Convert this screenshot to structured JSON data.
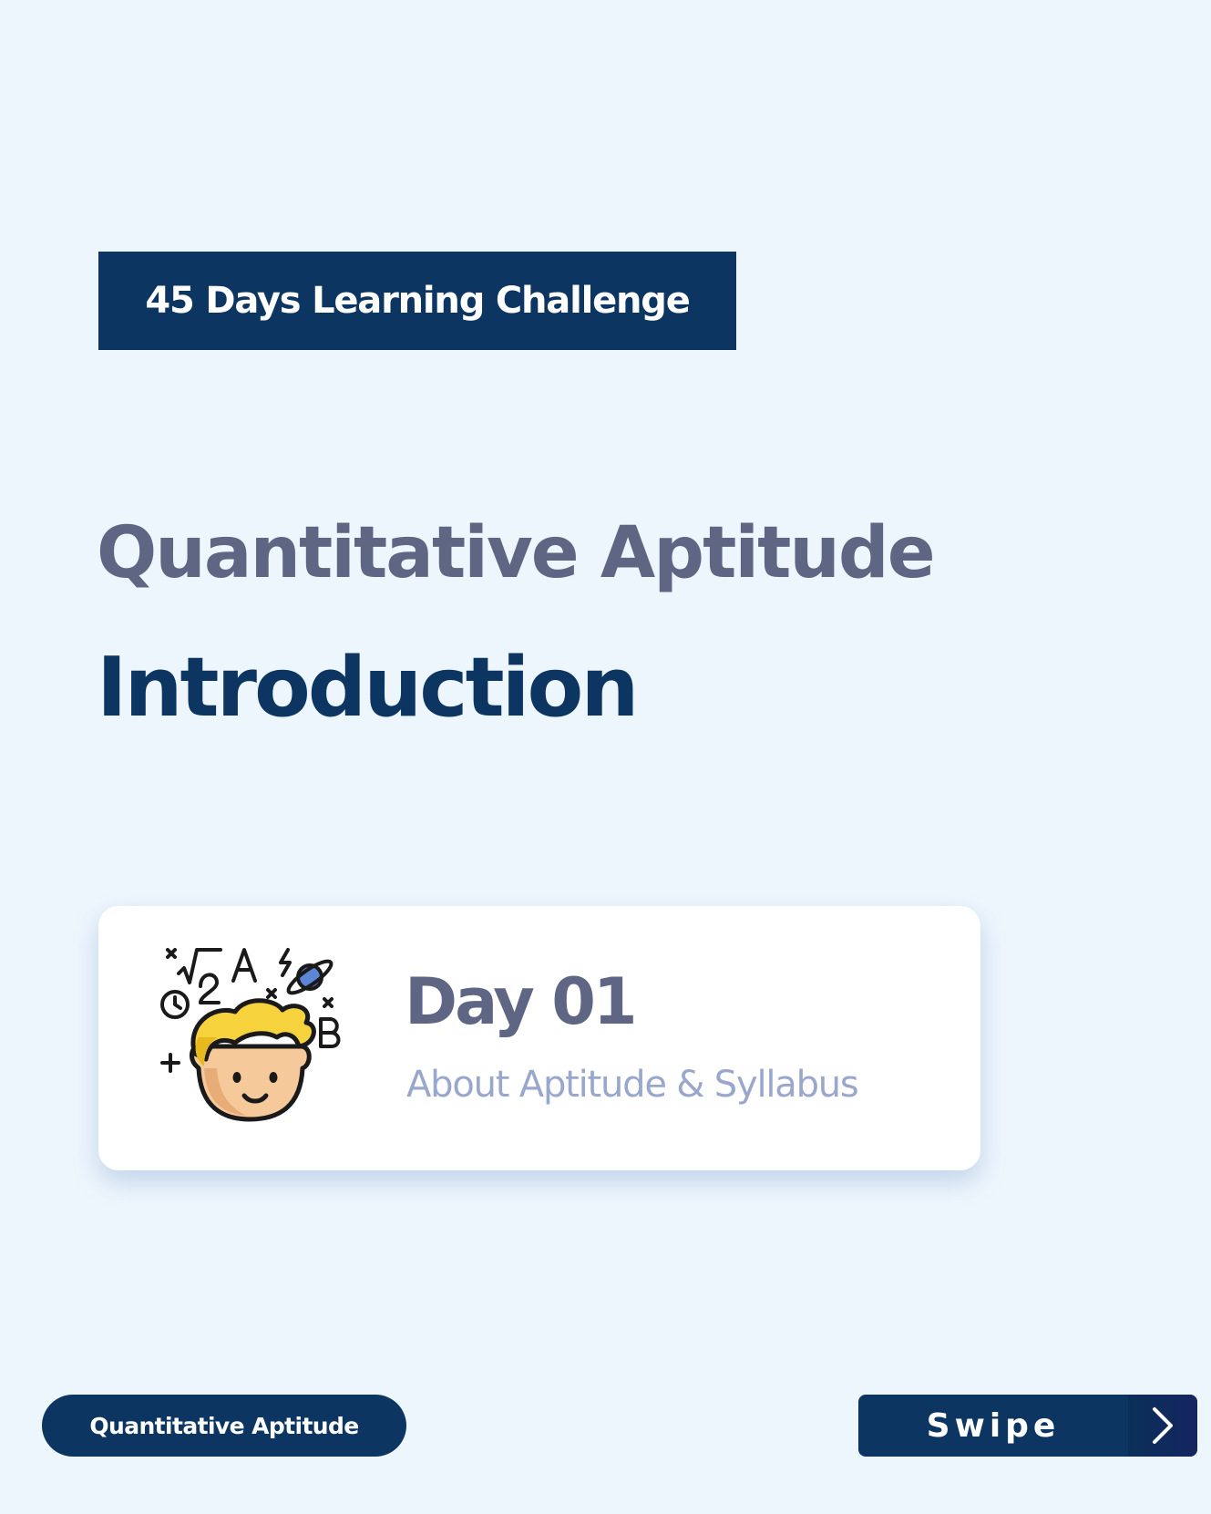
{
  "banner": {
    "label": "45 Days Learning Challenge"
  },
  "header": {
    "subject": "Quantitative Aptitude",
    "topic": "Introduction"
  },
  "card": {
    "day": "Day 01",
    "subtitle": "About Aptitude & Syllabus",
    "illustration": "student-thinking-math-icon"
  },
  "footer": {
    "category": "Quantitative Aptitude",
    "swipe_label": "Swipe",
    "swipe_icon": "chevron-right-icon"
  },
  "colors": {
    "background": "#eef6fd",
    "navy": "#0d3562",
    "slate": "#5e6684",
    "muted_blue": "#9aa7cc",
    "card": "#ffffff"
  }
}
